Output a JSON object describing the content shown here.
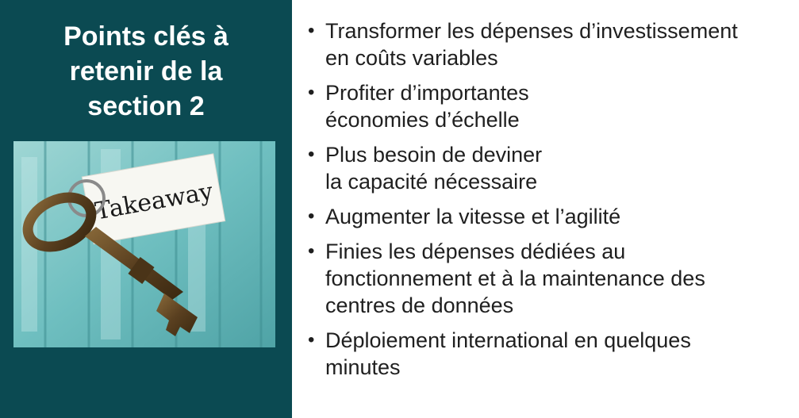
{
  "slide": {
    "title_lines": [
      "Points clés à",
      "retenir de la",
      "section 2"
    ],
    "image": {
      "tag_text": "Takeaway"
    },
    "bullet_glyph": "•",
    "bullets": [
      {
        "lines": [
          "Transformer les dépenses d’investissement",
          "en coûts variables"
        ]
      },
      {
        "lines": [
          "Profiter d’importantes",
          "économies d’échelle"
        ]
      },
      {
        "lines": [
          "Plus besoin de deviner",
          "la capacité nécessaire"
        ]
      },
      {
        "lines": [
          "Augmenter la vitesse et l’agilité"
        ]
      },
      {
        "lines": [
          "Finies les dépenses dédiées au",
          "fonctionnement et à la maintenance des",
          "centres de données"
        ]
      },
      {
        "lines": [
          "Déploiement international en quelques",
          "minutes"
        ]
      }
    ],
    "colors": {
      "panel": "#0b4a52",
      "text": "#1f1f1f",
      "wood": "#7fc6c6"
    }
  }
}
